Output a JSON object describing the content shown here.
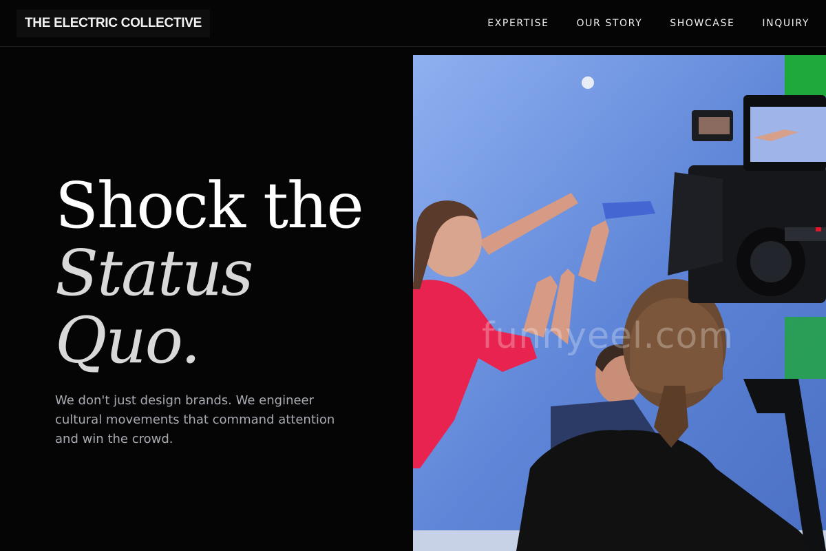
{
  "header": {
    "logo": "THE ELECTRIC COLLECTIVE",
    "nav": [
      "EXPERTISE",
      "OUR STORY",
      "SHOWCASE",
      "INQUIRY"
    ]
  },
  "hero": {
    "title_line1": "Shock the",
    "title_line2": "Status",
    "title_line3": "Quo.",
    "subtitle": "We don't just design brands. We engineer cultural movements that command attention and win the crowd.",
    "image_watermark": "funnyeel.com",
    "image_subject": "film crew with camera rig shooting people against a blue screen"
  },
  "colors": {
    "background": "#050505",
    "text": "#ffffff",
    "subtitle": "#a9abb2",
    "blue_screen": "#5b7fd0",
    "accent_red": "#e8234f"
  }
}
